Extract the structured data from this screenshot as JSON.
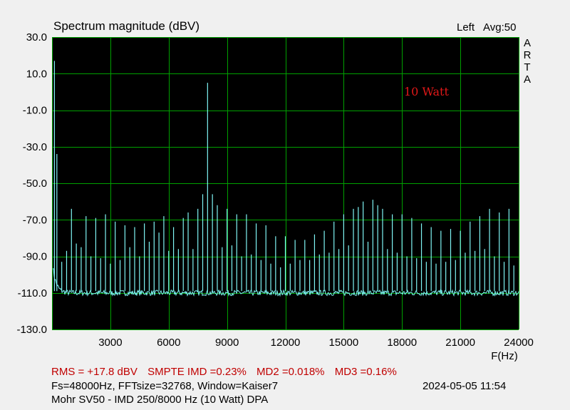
{
  "header": {
    "title": "Spectrum magnitude (dBV)",
    "channel": "Left",
    "averaging": "Avg:50",
    "brand_letters": [
      "A",
      "R",
      "T",
      "A"
    ]
  },
  "chart_data": {
    "type": "line",
    "title": "Spectrum magnitude (dBV)",
    "xlabel": "F(Hz)",
    "ylabel": "",
    "xlim": [
      0,
      24000
    ],
    "ylim": [
      -130,
      30
    ],
    "xticks": [
      "3000",
      "6000",
      "9000",
      "12000",
      "15000",
      "18000",
      "21000",
      "24000"
    ],
    "yticks": [
      "30.0",
      "10.0",
      "-10.0",
      "-30.0",
      "-50.0",
      "-70.0",
      "-90.0",
      "-110.0",
      "-130.0"
    ],
    "grid": true,
    "annotation": "10 Watt",
    "colors": {
      "background": "#000000",
      "grid": "#00a000",
      "trace": "#7ff5f5",
      "stats_text": "#c00000",
      "annotation": "#e01818"
    },
    "series": [
      {
        "noise_floor_db": -110,
        "peaks": [
          {
            "x": 125,
            "y": 17
          },
          {
            "x": 250,
            "y": -34
          },
          {
            "x": 500,
            "y": -93
          },
          {
            "x": 750,
            "y": -87
          },
          {
            "x": 1000,
            "y": -64
          },
          {
            "x": 1250,
            "y": -83
          },
          {
            "x": 1500,
            "y": -85
          },
          {
            "x": 1750,
            "y": -68
          },
          {
            "x": 2000,
            "y": -90
          },
          {
            "x": 2250,
            "y": -69
          },
          {
            "x": 2500,
            "y": -91
          },
          {
            "x": 2750,
            "y": -67
          },
          {
            "x": 3000,
            "y": -94
          },
          {
            "x": 3250,
            "y": -71
          },
          {
            "x": 3500,
            "y": -92
          },
          {
            "x": 3750,
            "y": -73
          },
          {
            "x": 4000,
            "y": -85
          },
          {
            "x": 4250,
            "y": -74
          },
          {
            "x": 4500,
            "y": -90
          },
          {
            "x": 4750,
            "y": -72
          },
          {
            "x": 5000,
            "y": -82
          },
          {
            "x": 5250,
            "y": -71
          },
          {
            "x": 5500,
            "y": -77
          },
          {
            "x": 5750,
            "y": -68
          },
          {
            "x": 6000,
            "y": -87
          },
          {
            "x": 6250,
            "y": -74
          },
          {
            "x": 6500,
            "y": -86
          },
          {
            "x": 6750,
            "y": -69
          },
          {
            "x": 7000,
            "y": -66
          },
          {
            "x": 7250,
            "y": -86
          },
          {
            "x": 7500,
            "y": -64
          },
          {
            "x": 7750,
            "y": -56
          },
          {
            "x": 8000,
            "y": 5
          },
          {
            "x": 8250,
            "y": -56
          },
          {
            "x": 8500,
            "y": -62
          },
          {
            "x": 8750,
            "y": -85
          },
          {
            "x": 9000,
            "y": -64
          },
          {
            "x": 9250,
            "y": -84
          },
          {
            "x": 9500,
            "y": -67
          },
          {
            "x": 9750,
            "y": -90
          },
          {
            "x": 10000,
            "y": -67
          },
          {
            "x": 10250,
            "y": -89
          },
          {
            "x": 10500,
            "y": -72
          },
          {
            "x": 10750,
            "y": -92
          },
          {
            "x": 11000,
            "y": -73
          },
          {
            "x": 11250,
            "y": -94
          },
          {
            "x": 11500,
            "y": -79
          },
          {
            "x": 11750,
            "y": -96
          },
          {
            "x": 12000,
            "y": -79
          },
          {
            "x": 12250,
            "y": -94
          },
          {
            "x": 12500,
            "y": -81
          },
          {
            "x": 12750,
            "y": -92
          },
          {
            "x": 13000,
            "y": -81
          },
          {
            "x": 13250,
            "y": -92
          },
          {
            "x": 13500,
            "y": -78
          },
          {
            "x": 13750,
            "y": -89
          },
          {
            "x": 14000,
            "y": -76
          },
          {
            "x": 14250,
            "y": -88
          },
          {
            "x": 14500,
            "y": -71
          },
          {
            "x": 14750,
            "y": -86
          },
          {
            "x": 15000,
            "y": -67
          },
          {
            "x": 15250,
            "y": -84
          },
          {
            "x": 15500,
            "y": -64
          },
          {
            "x": 15750,
            "y": -63
          },
          {
            "x": 16000,
            "y": -60
          },
          {
            "x": 16250,
            "y": -82
          },
          {
            "x": 16500,
            "y": -59
          },
          {
            "x": 16750,
            "y": -62
          },
          {
            "x": 17000,
            "y": -64
          },
          {
            "x": 17250,
            "y": -86
          },
          {
            "x": 17500,
            "y": -67
          },
          {
            "x": 17750,
            "y": -88
          },
          {
            "x": 18000,
            "y": -67
          },
          {
            "x": 18250,
            "y": -90
          },
          {
            "x": 18500,
            "y": -69
          },
          {
            "x": 18750,
            "y": -91
          },
          {
            "x": 19000,
            "y": -72
          },
          {
            "x": 19250,
            "y": -93
          },
          {
            "x": 19500,
            "y": -74
          },
          {
            "x": 19750,
            "y": -94
          },
          {
            "x": 20000,
            "y": -76
          },
          {
            "x": 20250,
            "y": -93
          },
          {
            "x": 20500,
            "y": -75
          },
          {
            "x": 20750,
            "y": -92
          },
          {
            "x": 21000,
            "y": -76
          },
          {
            "x": 21250,
            "y": -88
          },
          {
            "x": 21500,
            "y": -71
          },
          {
            "x": 21750,
            "y": -87
          },
          {
            "x": 22000,
            "y": -68
          },
          {
            "x": 22250,
            "y": -86
          },
          {
            "x": 22500,
            "y": -64
          },
          {
            "x": 22750,
            "y": -90
          },
          {
            "x": 23000,
            "y": -66
          },
          {
            "x": 23250,
            "y": -93
          },
          {
            "x": 23500,
            "y": -64
          },
          {
            "x": 23750,
            "y": -95
          }
        ]
      }
    ]
  },
  "footer": {
    "stats": [
      "RMS =  +17.8 dBV",
      "SMPTE IMD =0.23%",
      "MD2 =0.018%",
      "MD3 =0.16%"
    ],
    "settings": "Fs=48000Hz, FFTsize=32768, Window=Kaiser7",
    "timestamp": "2024-05-05   11:54",
    "description": "Mohr SV50 - IMD 250/8000 Hz (10 Watt)      DPA"
  }
}
